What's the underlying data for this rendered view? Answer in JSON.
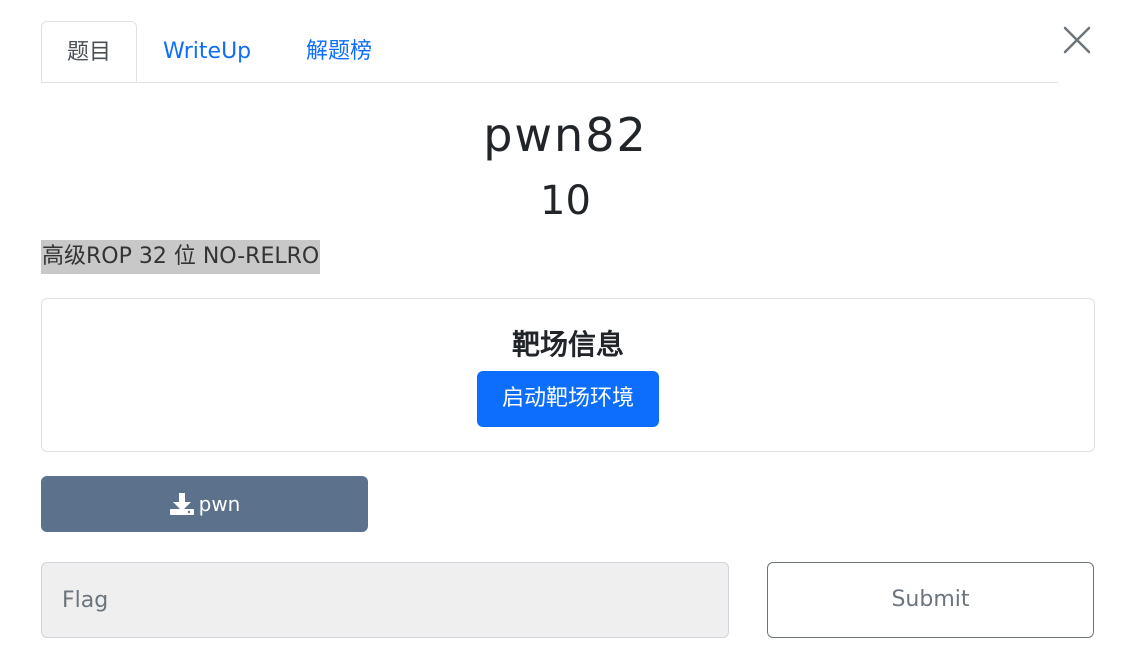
{
  "tabs": [
    {
      "label": "题目",
      "active": true
    },
    {
      "label": "WriteUp",
      "active": false
    },
    {
      "label": "解题榜",
      "active": false
    }
  ],
  "challenge": {
    "name": "pwn82",
    "points": "10",
    "description": "高级ROP 32 位 NO-RELRO"
  },
  "target_card": {
    "title": "靶场信息",
    "start_button": "启动靶场环境"
  },
  "download": {
    "icon": "download-icon",
    "label": "pwn"
  },
  "flag_form": {
    "placeholder": "Flag",
    "value": "",
    "submit_label": "Submit"
  },
  "colors": {
    "primary": "#0d6efd",
    "download_button": "#5c718c",
    "description_highlight": "#c8c8c8"
  }
}
